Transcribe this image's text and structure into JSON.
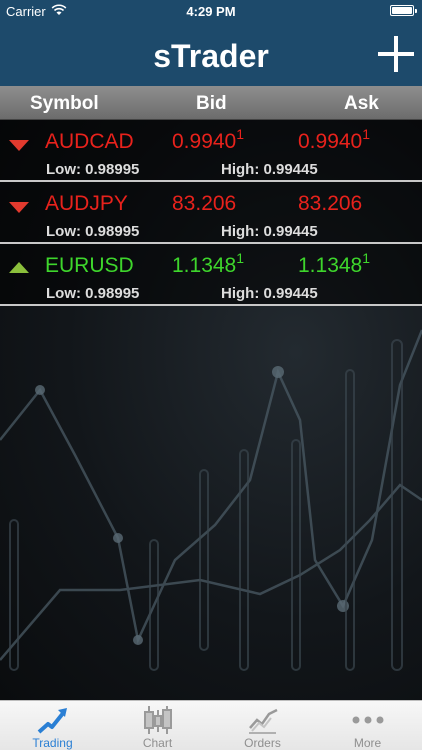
{
  "status": {
    "carrier": "Carrier",
    "time": "4:29 PM"
  },
  "nav": {
    "title": "sTrader"
  },
  "columns": {
    "symbol": "Symbol",
    "bid": "Bid",
    "ask": "Ask"
  },
  "quotes": [
    {
      "symbol": "AUDCAD",
      "direction": "down",
      "color": "#e8221c",
      "bid": "0.9940",
      "bid_sup": "1",
      "ask": "0.9940",
      "ask_sup": "1",
      "low": "Low: 0.98995",
      "high": "High: 0.99445"
    },
    {
      "symbol": "AUDJPY",
      "direction": "down",
      "color": "#e8221c",
      "bid": "83.206",
      "bid_sup": "",
      "ask": "83.206",
      "ask_sup": "",
      "low": "Low: 0.98995",
      "high": "High: 0.99445"
    },
    {
      "symbol": "EURUSD",
      "direction": "up",
      "color": "#3ed62c",
      "bid": "1.1348",
      "bid_sup": "1",
      "ask": "1.1348",
      "ask_sup": "1",
      "low": "Low: 0.98995",
      "high": "High: 0.99445"
    }
  ],
  "tabs": [
    {
      "label": "Trading",
      "icon": "trading-icon",
      "active": true
    },
    {
      "label": "Chart",
      "icon": "candlestick-icon",
      "active": false
    },
    {
      "label": "Orders",
      "icon": "orders-chart-icon",
      "active": false
    },
    {
      "label": "More",
      "icon": "more-dots-icon",
      "active": false
    }
  ],
  "colors": {
    "bar": "#1d4a6b",
    "down": "#e8221c",
    "up": "#3ed62c",
    "active_tab": "#2a7fd4"
  }
}
